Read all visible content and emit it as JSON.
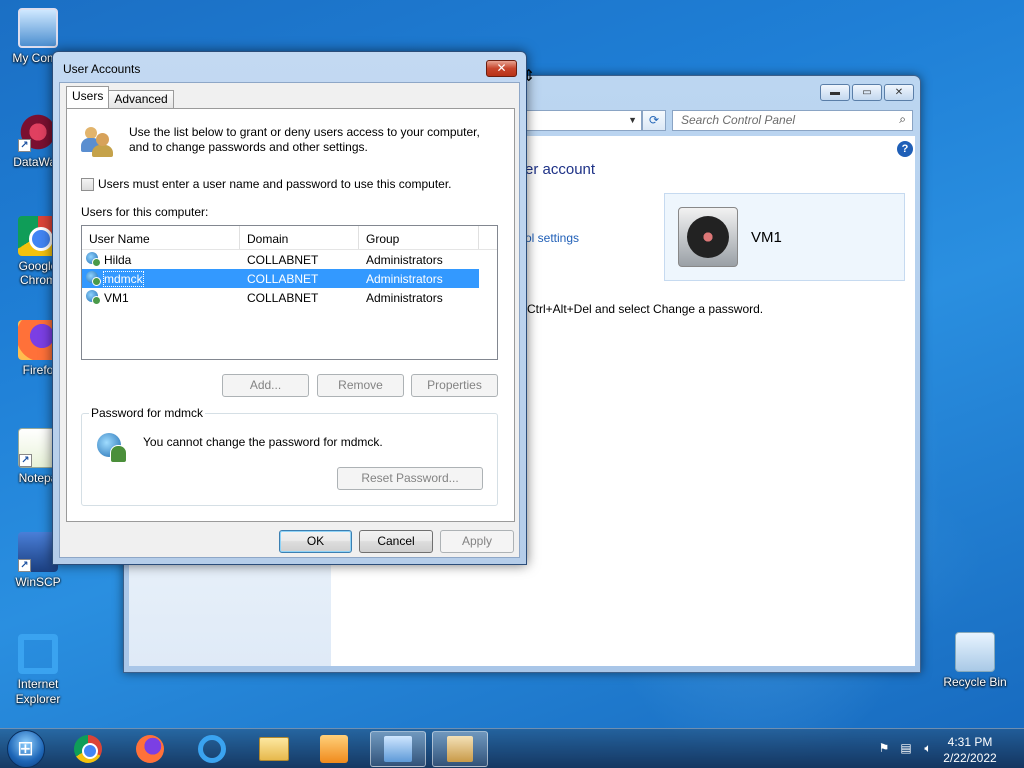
{
  "desktop": {
    "icons": [
      {
        "label": "My Comp",
        "icon": "computer-icon"
      },
      {
        "label": "DataWag",
        "icon": "datawagon-icon"
      },
      {
        "label": "Google Chrom",
        "icon": "chrome-icon"
      },
      {
        "label": "Firefo",
        "icon": "firefox-icon"
      },
      {
        "label": "Notepa",
        "icon": "notepad-icon"
      },
      {
        "label": "WinSCP",
        "icon": "winscp-icon"
      },
      {
        "label": "Internet Explorer",
        "icon": "internet-explorer-icon"
      },
      {
        "label": "Recycle Bin",
        "icon": "recycle-bin-icon"
      }
    ]
  },
  "control_panel": {
    "search_placeholder": "Search Control Panel",
    "heading": "er account",
    "link": "ol settings",
    "account_name": "VM1",
    "ctrl_alt_text": "Ctrl+Alt+Del and select Change a password."
  },
  "dialog": {
    "title": "User Accounts",
    "close_label": "✕",
    "tabs": [
      {
        "label": "Users",
        "active": true
      },
      {
        "label": "Advanced",
        "active": false
      }
    ],
    "intro": "Use the list below to grant or deny users access to your computer, and to change passwords and other settings.",
    "checkbox_label": "Users must enter a user name and password to use this computer.",
    "checkbox_checked": false,
    "users_label": "Users for this computer:",
    "columns": [
      "User Name",
      "Domain",
      "Group"
    ],
    "users": [
      {
        "name": "Hilda",
        "domain": "COLLABNET",
        "group": "Administrators",
        "selected": false
      },
      {
        "name": "mdmck",
        "domain": "COLLABNET",
        "group": "Administrators",
        "selected": true
      },
      {
        "name": "VM1",
        "domain": "COLLABNET",
        "group": "Administrators",
        "selected": false
      }
    ],
    "buttons": {
      "add": "Add...",
      "remove": "Remove",
      "properties": "Properties",
      "reset_password": "Reset Password...",
      "ok": "OK",
      "cancel": "Cancel",
      "apply": "Apply"
    },
    "password_group_label": "Password for mdmck",
    "password_text": "You cannot change the password for mdmck."
  },
  "taskbar": {
    "time": "4:31 PM",
    "date": "2/22/2022"
  }
}
